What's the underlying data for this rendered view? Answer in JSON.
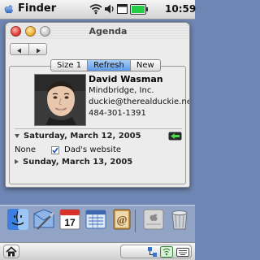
{
  "statusbar": {
    "app_title": "Finder",
    "clock": "10:59",
    "icons": [
      "apple-icon",
      "wifi-icon",
      "volume-icon",
      "window-icon",
      "battery-icon"
    ],
    "battery_color": "#22cc44"
  },
  "window": {
    "title": "Agenda",
    "tabs": [
      {
        "label": "Size 1",
        "active": false
      },
      {
        "label": "Refresh",
        "active": true
      },
      {
        "label": "New",
        "active": false
      }
    ]
  },
  "contact": {
    "name": "David Wasman",
    "company": "Mindbridge, Inc.",
    "email": "duckie@therealduckie.net",
    "phone": "484-301-1391"
  },
  "agenda": {
    "day1": "Saturday, March 12, 2005",
    "event_time": "None",
    "event_checked": true,
    "event_title": "Dad's website",
    "day2": "Sunday, March 13, 2005"
  },
  "dock": {
    "items": [
      "finder-icon",
      "mail-icon",
      "calendar-icon",
      "dashboard-icon",
      "address-book-icon",
      "system-preferences-icon",
      "trash-icon"
    ],
    "calendar_date": "17"
  }
}
